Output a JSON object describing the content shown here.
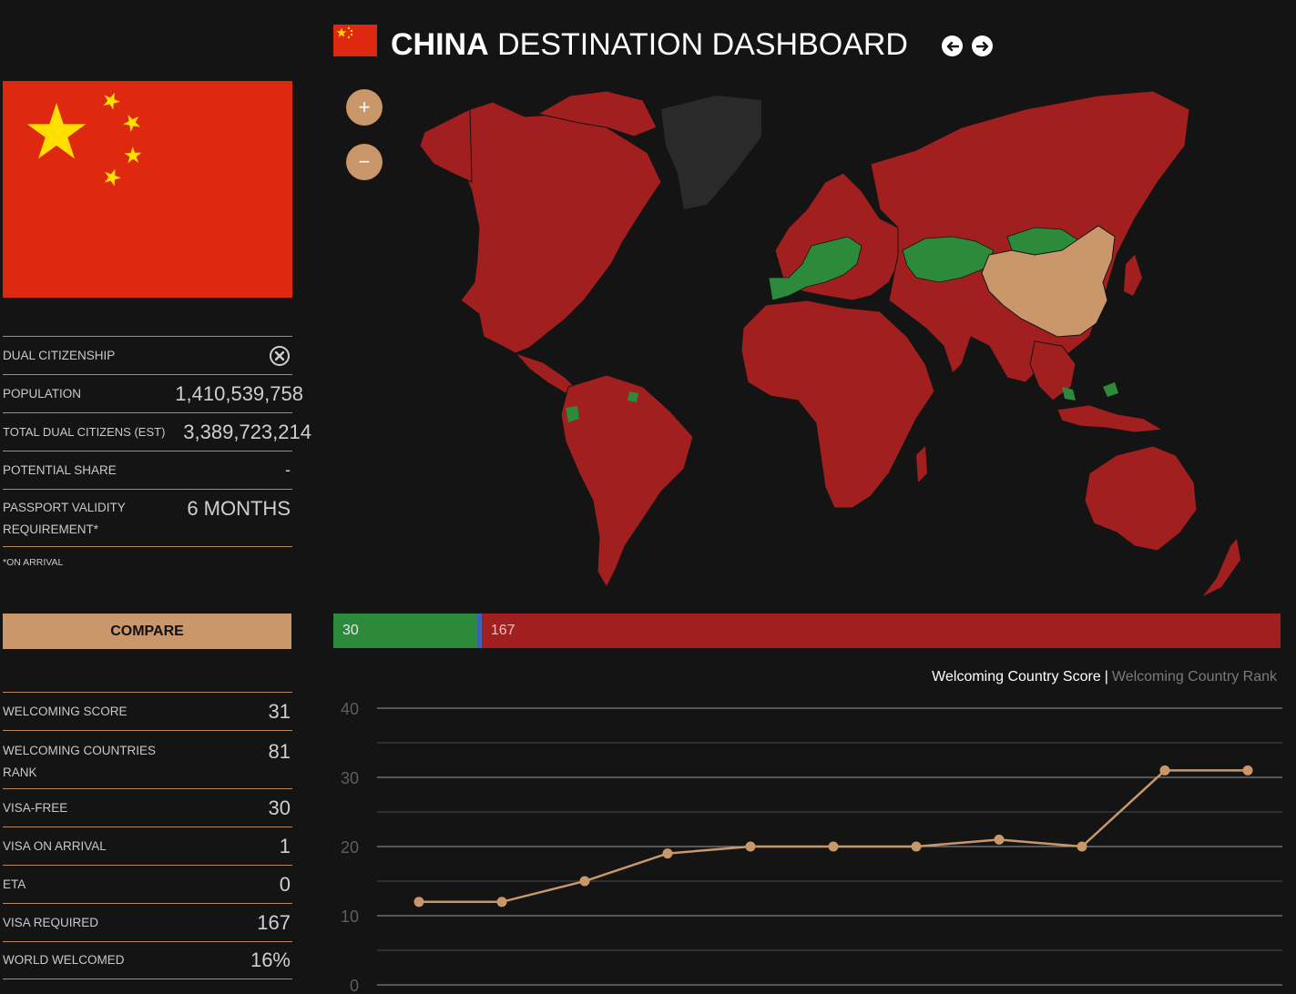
{
  "header": {
    "country": "CHINA",
    "title_rest": "DESTINATION DASHBOARD",
    "prev_icon": "arrow-left-icon",
    "next_icon": "arrow-right-icon"
  },
  "colors": {
    "background": "#141414",
    "accent": "#c9976a",
    "visa_free": "#2c8a3b",
    "visa_on_arrival": "#3a63b8",
    "visa_required": "#a11f1f",
    "home_country": "#c9976a",
    "no_data": "#2a2a2a"
  },
  "profile": {
    "rows": [
      {
        "label": "DUAL CITIZENSHIP",
        "value": "",
        "icon": "x-circle-icon"
      },
      {
        "label": "POPULATION",
        "value": "1,410,539,758"
      },
      {
        "label": "TOTAL DUAL CITIZENS (EST)",
        "value": "3,389,723,214"
      },
      {
        "label": "POTENTIAL SHARE",
        "value": "-"
      },
      {
        "label": "PASSPORT VALIDITY REQUIREMENT*",
        "value": "6 MONTHS"
      }
    ],
    "footnote": "*ON ARRIVAL"
  },
  "compare_label": "COMPARE",
  "scores": {
    "rows": [
      {
        "label": "WELCOMING SCORE",
        "value": "31"
      },
      {
        "label": "WELCOMING COUNTRIES RANK",
        "value": "81"
      },
      {
        "label": "VISA-FREE",
        "value": "30"
      },
      {
        "label": "VISA ON ARRIVAL",
        "value": "1"
      },
      {
        "label": "ETA",
        "value": "0"
      },
      {
        "label": "VISA REQUIRED",
        "value": "167"
      },
      {
        "label": "WORLD WELCOMED",
        "value": "16%"
      }
    ]
  },
  "map": {
    "zoom_in": "+",
    "zoom_out": "−"
  },
  "summary_bar": {
    "visa_free": 30,
    "visa_on_arrival": 1,
    "visa_required": 167,
    "visa_free_label": "30",
    "visa_required_label": "167"
  },
  "chart_tabs": {
    "active": "Welcoming Country Score",
    "separator": "|",
    "inactive": "Welcoming Country Rank"
  },
  "chart_data": {
    "type": "line",
    "title": "",
    "xlabel": "",
    "ylabel": "",
    "ylim": [
      0,
      40
    ],
    "yticks": [
      0,
      10,
      20,
      30,
      40
    ],
    "grid": true,
    "color": "#c9976a",
    "series": [
      {
        "values": [
          12,
          12,
          15,
          19,
          20,
          20,
          20,
          21,
          20,
          31,
          31
        ]
      }
    ]
  }
}
